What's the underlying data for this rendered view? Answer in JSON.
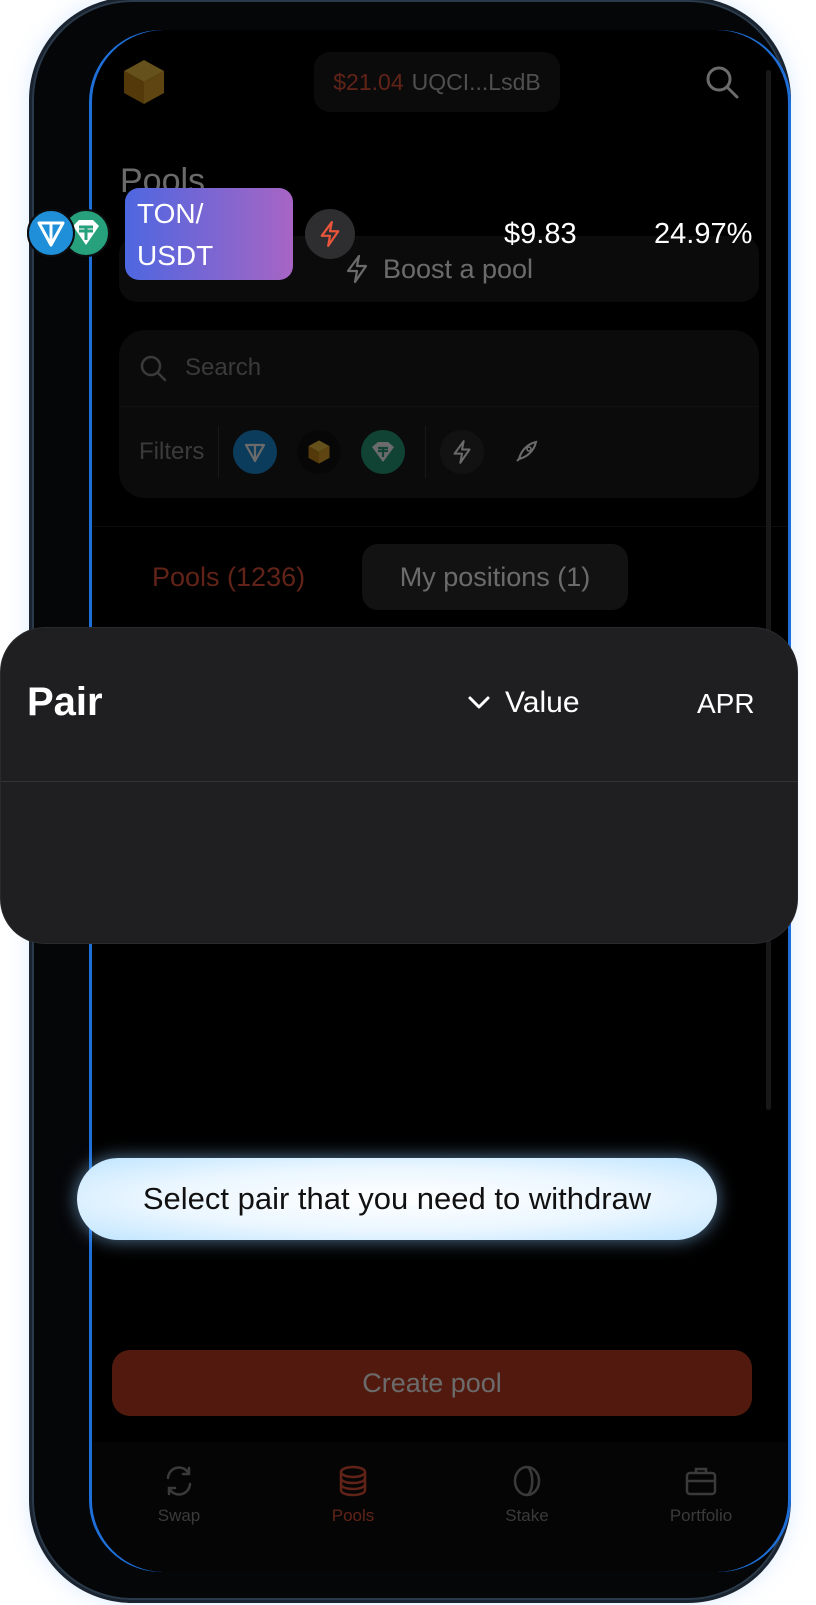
{
  "header": {
    "balance": "$21.04",
    "address": "UQCI...LsdB"
  },
  "page": {
    "title": "Pools",
    "boost_label": "Boost a pool"
  },
  "search": {
    "placeholder": "Search",
    "filters_label": "Filters"
  },
  "tabs": [
    {
      "label": "Pools (1236)",
      "active": true
    },
    {
      "label": "My positions (1)",
      "active": false
    }
  ],
  "table": {
    "columns": {
      "pair": "Pair",
      "value": "Value",
      "apr": "APR"
    },
    "rows": [
      {
        "pair_line1": "TON/",
        "pair_line2": "USDT",
        "value": "$9.83",
        "apr": "24.97%"
      }
    ]
  },
  "tooltip": "Select pair that you need to withdraw",
  "create_button": "Create pool",
  "nav": [
    {
      "label": "Swap",
      "icon": "swap-icon"
    },
    {
      "label": "Pools",
      "icon": "pools-icon",
      "active": true
    },
    {
      "label": "Stake",
      "icon": "stake-icon"
    },
    {
      "label": "Portfolio",
      "icon": "portfolio-icon"
    }
  ],
  "colors": {
    "accent": "#e8553a",
    "ton_blue": "#1e8fd8",
    "usdt_teal": "#26a17b",
    "pair_gradient_start": "#4e67e0",
    "pair_gradient_end": "#a765c4"
  }
}
